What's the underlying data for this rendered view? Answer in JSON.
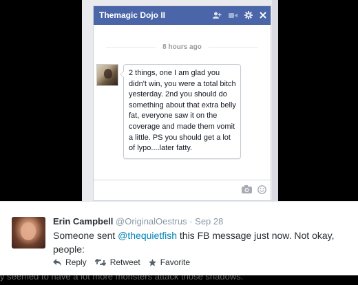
{
  "chat": {
    "title": "Themagic Dojo II",
    "timestamp": "8 hours ago",
    "message": "2 things, one I am glad you didn't win, you were a total bitch yesterday. 2nd you should do something about that extra belly fat, everyone saw it on the coverage and made them vomit a little. PS you should get a lot of lypo....later fatty.",
    "icons": {
      "add_friend": "add-friend-icon",
      "video": "video-camera-icon",
      "settings": "gear-icon",
      "close": "close-icon",
      "photo": "camera-icon",
      "sticker": "smiley-icon"
    },
    "colors": {
      "header": "#4a66a8",
      "border": "#c4c9d2"
    }
  },
  "tweet": {
    "name": "Erin Campbell",
    "handle": "@OriginalOestrus",
    "separator": "·",
    "date": "Sep 28",
    "text_before": "Someone sent ",
    "mention": "@thequietfish",
    "text_after": " this FB message just now. Not okay, people:",
    "actions": {
      "reply": "Reply",
      "retweet": "Retweet",
      "favorite": "Favorite"
    },
    "colors": {
      "link": "#0084b4",
      "muted": "#8899a6"
    }
  },
  "background_fragment": "y seemed to have a lot more monsters attack those shadows."
}
